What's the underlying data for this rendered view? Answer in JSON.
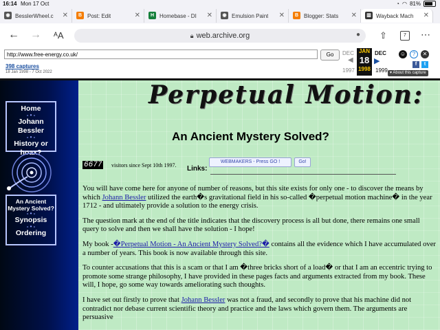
{
  "status_bar": {
    "time": "16:14",
    "date": "Mon 17 Oct",
    "battery": "81%"
  },
  "tabs": [
    {
      "label": "BesslerWheel.c",
      "icon": "ghost-icon",
      "color": "#555555",
      "active": false
    },
    {
      "label": "Post: Edit",
      "icon": "blogger-icon",
      "color": "#f57d00",
      "active": false
    },
    {
      "label": "Homebase - DI",
      "icon": "homebase-icon",
      "color": "#16803c",
      "active": false
    },
    {
      "label": "Emulsion Paint",
      "icon": "ghost-icon",
      "color": "#555555",
      "active": false
    },
    {
      "label": "Blogger: Stats",
      "icon": "blogger-icon",
      "color": "#f57d00",
      "active": false
    },
    {
      "label": "Wayback Mach",
      "icon": "archive-icon",
      "color": "#333333",
      "active": true
    }
  ],
  "address_bar": {
    "url": "web.archive.org",
    "tabs_count": "7"
  },
  "wayback": {
    "archived_url": "http://www.free-energy.co.uk/",
    "go_label": "Go",
    "captures": "398 captures",
    "range": "18 Jan 1998 - 7 Oct 2022",
    "prev_month": "DEC",
    "prev_year": "1997",
    "cur_month": "JAN",
    "cur_day": "18",
    "cur_year": "1998",
    "next_month": "DEC",
    "next_year": "1999",
    "about_label": "About this capture"
  },
  "sidebar": {
    "box1": [
      "Home",
      "Johann Bessler",
      "History or hoax?"
    ],
    "box2": [
      "An Ancient Mystery Solved?",
      "Synopsis",
      "Ordering"
    ]
  },
  "page": {
    "title": "Perpetual Motion:",
    "subtitle": "An Ancient Mystery Solved?",
    "counter": "6677",
    "counter_text": "visitors since Sept 10th 1997.",
    "links_label": "Links:",
    "webmakers_label": "WEBMAKERS - Press GO !",
    "webmakers_go": "Go!",
    "paragraphs": {
      "p1_a": "You will have come here for anyone of number of reasons, but this site exists for only one - to discover the means by which ",
      "p1_link": "Johann Bessler",
      "p1_b": " utilized the earth�s gravitational field in his so-called �perpetual motion machine� in the year 1712 - and ultimately provide a solution to the energy crisis.",
      "p2": "The question mark at the end of the title indicates that the discovery process is all but done, there remains one small query to solve and then we shall have the solution - I hope!",
      "p3_a": "My book -",
      "p3_link": "�Perpetual Motion - An Ancient Mystery Solved?�",
      "p3_b": " contains all the evidence which I have accumulated over a number of years. This book is now available through this site.",
      "p4": "To counter accusations that this is a scam or that I am �three bricks short of a load� or that I am an eccentric trying to promote some strange philosophy, I have provided in these pages facts and arguments extracted from my book. These will, I hope, go some way towards ameliorating such thoughts.",
      "p5_a": "I have set out firstly to prove that ",
      "p5_link": "Johann Bessler",
      "p5_b": " was not a fraud, and secondly to prove that his machine did not contradict nor debase current scientific theory and practice and the laws which govern them. The arguments are persuasive"
    }
  }
}
